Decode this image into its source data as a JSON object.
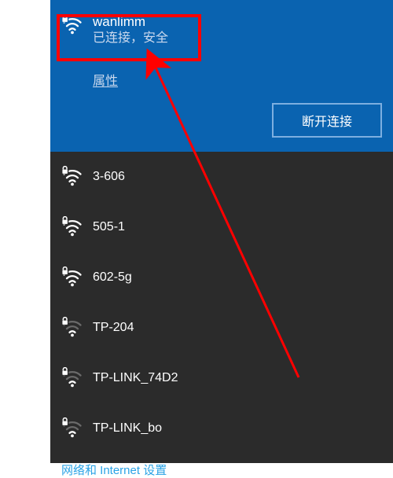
{
  "connected": {
    "ssid": "wanlimm",
    "status": "已连接，安全",
    "properties_label": "属性",
    "disconnect_label": "断开连接"
  },
  "networks": [
    {
      "ssid": "3-606",
      "secure": true,
      "strength": 4
    },
    {
      "ssid": "505-1",
      "secure": true,
      "strength": 4
    },
    {
      "ssid": "602-5g",
      "secure": true,
      "strength": 4
    },
    {
      "ssid": "TP-204",
      "secure": true,
      "strength": 2
    },
    {
      "ssid": "TP-LINK_74D2",
      "secure": true,
      "strength": 2
    },
    {
      "ssid": "TP-LINK_bo",
      "secure": true,
      "strength": 2
    }
  ],
  "settings_link": "网络和 Internet 设置",
  "annotations": {
    "highlight_target": "connected-network",
    "arrow_from": "bottom-right",
    "arrow_to": "highlight-box"
  }
}
